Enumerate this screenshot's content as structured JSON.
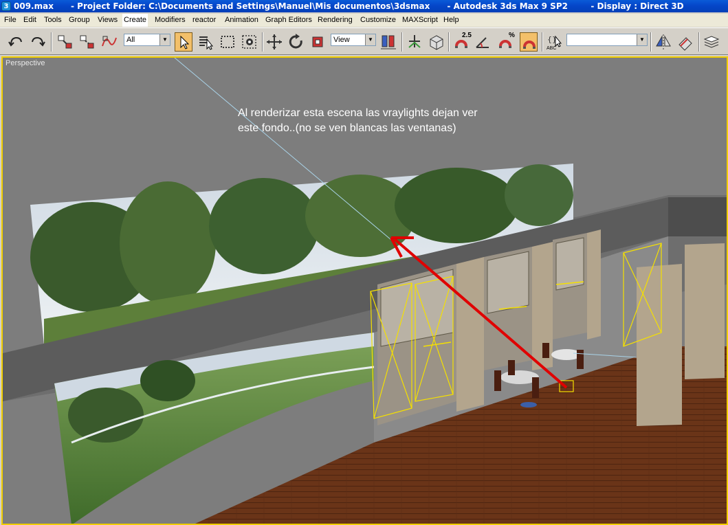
{
  "window": {
    "app_icon": "3ds-max-icon",
    "title": "009.max      - Project Folder: C:\\Documents and Settings\\Manuel\\Mis documentos\\3dsmax      - Autodesk 3ds Max 9 SP2        - Display : Direct 3D"
  },
  "menu": {
    "items": [
      "File",
      "Edit",
      "Tools",
      "Group",
      "Views",
      "Create",
      "Modifiers",
      "reactor",
      "Animation",
      "Graph Editors",
      "Rendering",
      "Customize",
      "MAXScript",
      "Help"
    ],
    "active": "Create"
  },
  "toolbar": {
    "selection_filter": "All",
    "reference_coord": "View",
    "angle_snap_label": "2.5",
    "percent_snap_label": "%",
    "named_selection_set": "",
    "edit_named_label": "ABC",
    "icons": [
      "undo-icon",
      "redo-icon",
      "select-and-link-icon",
      "unlink-icon",
      "bind-space-warp-icon",
      "select-object-icon",
      "select-by-name-icon",
      "rectangular-region-icon",
      "window-crossing-icon",
      "select-and-move-icon",
      "select-and-rotate-icon",
      "select-and-scale-icon",
      "use-pivot-center-icon",
      "select-and-manipulate-icon",
      "keyboard-shortcut-override-icon",
      "snaps-toggle-icon",
      "angle-snap-icon",
      "percent-snap-icon",
      "spinner-snap-icon",
      "edit-named-selection-icon",
      "mirror-icon",
      "align-icon",
      "layer-manager-icon"
    ]
  },
  "viewport": {
    "label": "Perspective",
    "annotation_text": "Al renderizar esta escena las vraylights dejan ver este fondo..(no se ven blancas las ventanas)",
    "border_color": "#f1ce00",
    "background_color": "#7d7d7d",
    "arrow_color": "#e00000",
    "light_gizmo_color": "#f5e000"
  }
}
